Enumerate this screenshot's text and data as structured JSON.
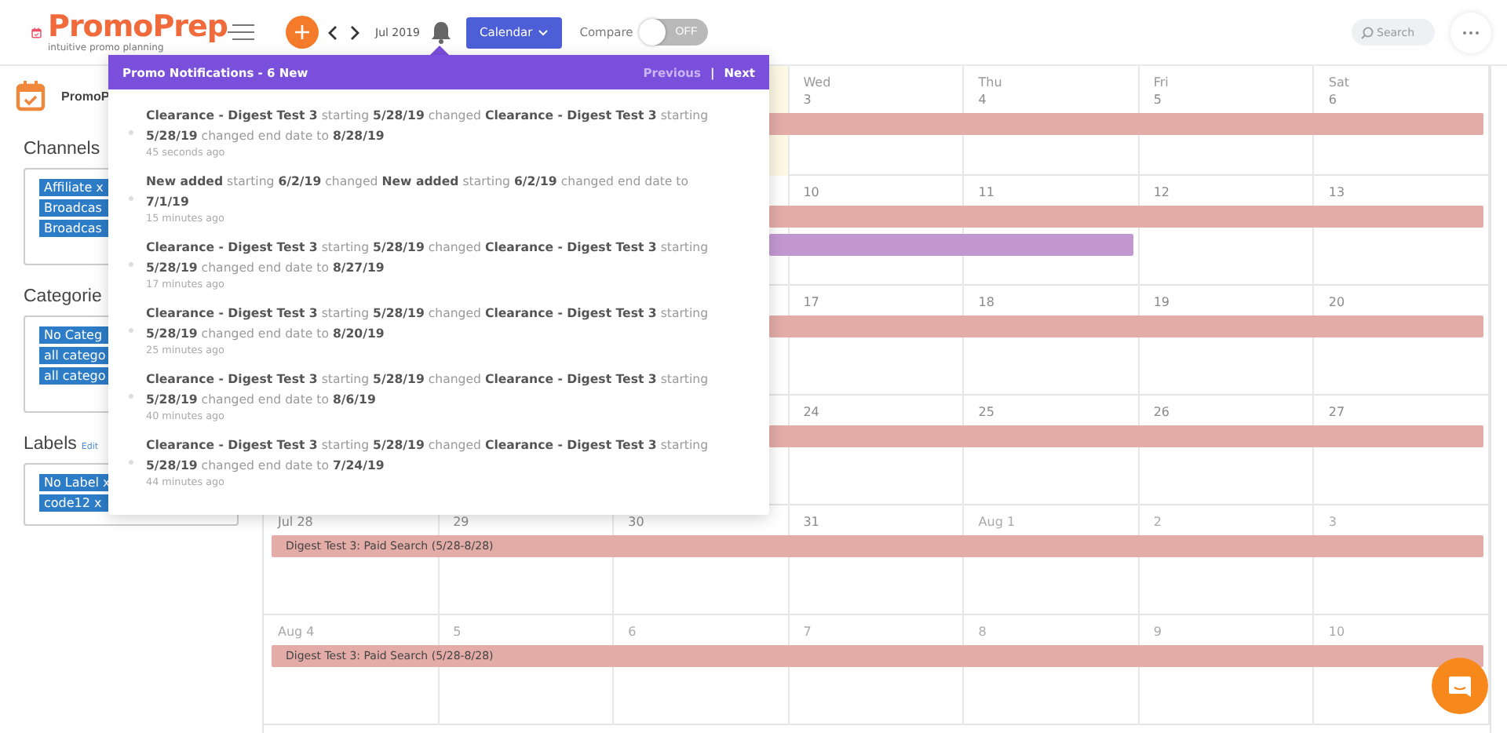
{
  "header": {
    "brand": "PromoPrep",
    "tagline": "intuitive promo planning",
    "month": "Jul 2019",
    "view_button": "Calendar",
    "compare": {
      "label": "Compare",
      "on": false,
      "state_text": "OFF"
    },
    "search": {
      "placeholder": "Search"
    }
  },
  "sidebar": {
    "project": "PromoP",
    "sections": [
      {
        "title": "Channels",
        "tags": [
          "Affiliate x",
          "Broadcas",
          "Broadcas"
        ]
      },
      {
        "title": "Categorie",
        "tags": [
          "No Categ",
          "all catego",
          "all catego"
        ]
      },
      {
        "title": "Labels",
        "edit": "Edit",
        "tags": [
          "No Label x",
          "code12 x"
        ]
      }
    ]
  },
  "notifications": {
    "title": "Promo Notifications - 6 New",
    "previous": "Previous",
    "separator": "|",
    "next": "Next",
    "items": [
      {
        "text": "**Clearance - Digest Test 3** starting **5/28/19** changed **Clearance - Digest Test 3** starting **5/28/19** changed end date to **8/28/19**",
        "time": "45 seconds ago"
      },
      {
        "text": "**New added** starting **6/2/19** changed **New added** starting **6/2/19** changed end date to **7/1/19**",
        "time": "15 minutes ago"
      },
      {
        "text": "**Clearance - Digest Test 3** starting **5/28/19** changed **Clearance - Digest Test 3** starting **5/28/19** changed end date to **8/27/19**",
        "time": "17 minutes ago"
      },
      {
        "text": "**Clearance - Digest Test 3** starting **5/28/19** changed **Clearance - Digest Test 3** starting **5/28/19** changed end date to **8/20/19**",
        "time": "25 minutes ago"
      },
      {
        "text": "**Clearance - Digest Test 3** starting **5/28/19** changed **Clearance - Digest Test 3** starting **5/28/19** changed end date to **8/6/19**",
        "time": "40 minutes ago"
      },
      {
        "text": "**Clearance - Digest Test 3** starting **5/28/19** changed **Clearance - Digest Test 3** starting **5/28/19** changed end date to **7/24/19**",
        "time": "44 minutes ago"
      }
    ]
  },
  "calendar": {
    "weeks": [
      {
        "days": [
          {
            "today": true
          },
          {
            "name": "Wed",
            "date": "3"
          },
          {
            "name": "Thu",
            "date": "4"
          },
          {
            "name": "Fri",
            "date": "5"
          },
          {
            "name": "Sat",
            "date": "6"
          }
        ],
        "events": [
          {
            "kind": "continued",
            "color": "#e3aca7"
          }
        ]
      },
      {
        "days": [
          {
            "date": "10"
          },
          {
            "date": "11"
          },
          {
            "date": "12"
          },
          {
            "date": "13"
          }
        ],
        "events": [
          {
            "kind": "continued",
            "color": "#e3aca7"
          },
          {
            "kind": "continued-short",
            "color": "#c398d1"
          }
        ]
      },
      {
        "days": [
          {
            "date": "17"
          },
          {
            "date": "18"
          },
          {
            "date": "19"
          },
          {
            "date": "20"
          }
        ],
        "events": [
          {
            "kind": "continued",
            "color": "#e3aca7"
          }
        ]
      },
      {
        "days": [
          {
            "date": "24"
          },
          {
            "date": "25"
          },
          {
            "date": "26"
          },
          {
            "date": "27"
          }
        ],
        "events": [
          {
            "kind": "continued",
            "color": "#e3aca7"
          }
        ]
      },
      {
        "days": [
          {
            "date": "Jul 28",
            "muted": false
          },
          {
            "date": "29",
            "muted": false
          },
          {
            "date": "30",
            "muted": false
          },
          {
            "date": "31",
            "muted": false
          },
          {
            "date": "Aug 1",
            "muted": true
          },
          {
            "date": "2",
            "muted": true
          },
          {
            "date": "3",
            "muted": true
          }
        ],
        "events": [
          {
            "kind": "week",
            "color": "#e3aca7",
            "label": "Digest Test 3: Paid Search (5/28-8/28)"
          }
        ]
      },
      {
        "days": [
          {
            "date": "Aug 4",
            "muted": true
          },
          {
            "date": "5",
            "muted": true
          },
          {
            "date": "6",
            "muted": true
          },
          {
            "date": "7",
            "muted": true
          },
          {
            "date": "8",
            "muted": true
          },
          {
            "date": "9",
            "muted": true
          },
          {
            "date": "10",
            "muted": true
          }
        ],
        "events": [
          {
            "kind": "week",
            "color": "#e3aca7",
            "label": "Digest Test 3: Paid Search (5/28-8/28)"
          }
        ]
      }
    ]
  }
}
